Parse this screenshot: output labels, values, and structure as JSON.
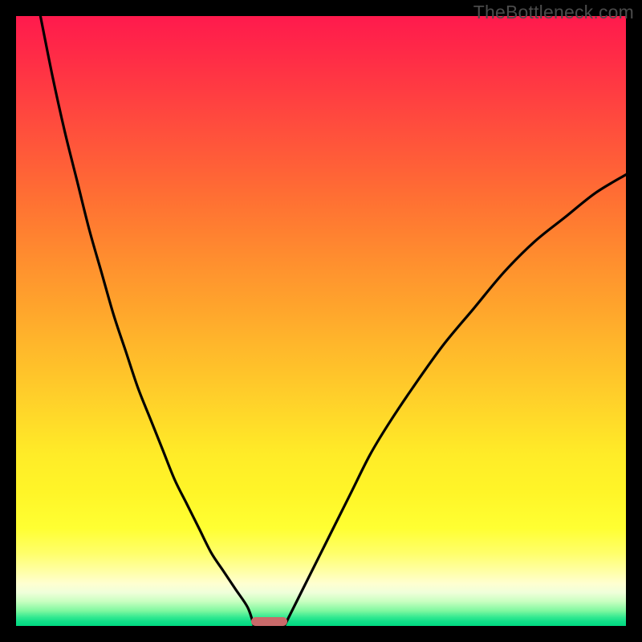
{
  "watermark": "TheBottleneck.com",
  "chart_data": {
    "type": "line",
    "title": "",
    "xlabel": "",
    "ylabel": "",
    "xlim": [
      0,
      100
    ],
    "ylim": [
      0,
      100
    ],
    "grid": false,
    "legend": false,
    "gradient_stops": [
      {
        "pct": 0,
        "color": "#ff1a4d"
      },
      {
        "pct": 50,
        "color": "#ffb02b"
      },
      {
        "pct": 85,
        "color": "#ffff32"
      },
      {
        "pct": 100,
        "color": "#00d880"
      }
    ],
    "series": [
      {
        "name": "left-curve",
        "x": [
          4,
          6,
          8,
          10,
          12,
          14,
          16,
          18,
          20,
          22,
          24,
          26,
          28,
          30,
          32,
          34,
          36,
          38,
          39
        ],
        "values": [
          100,
          90,
          81,
          73,
          65,
          58,
          51,
          45,
          39,
          34,
          29,
          24,
          20,
          16,
          12,
          9,
          6,
          3,
          0
        ]
      },
      {
        "name": "right-curve",
        "x": [
          44,
          46,
          48,
          50,
          52,
          55,
          58,
          61,
          65,
          70,
          75,
          80,
          85,
          90,
          95,
          100
        ],
        "values": [
          0,
          4,
          8,
          12,
          16,
          22,
          28,
          33,
          39,
          46,
          52,
          58,
          63,
          67,
          71,
          74
        ]
      }
    ],
    "marker": {
      "name": "sweet-spot-marker",
      "x_start": 38.5,
      "x_end": 44.5,
      "y": 0,
      "color": "#c96a6a"
    }
  }
}
